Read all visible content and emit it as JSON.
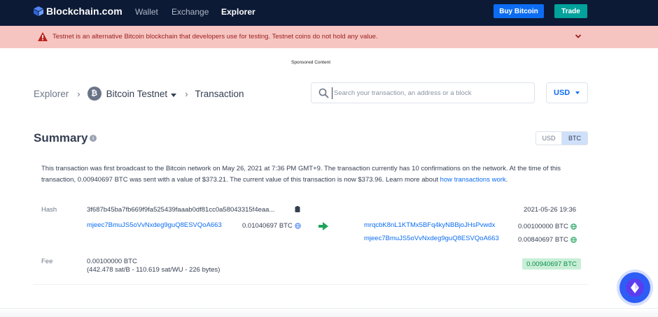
{
  "brand": {
    "name": "Blockchain.com"
  },
  "nav": {
    "links": [
      {
        "label": "Wallet",
        "active": false
      },
      {
        "label": "Exchange",
        "active": false
      },
      {
        "label": "Explorer",
        "active": true
      }
    ],
    "buy_button": "Buy Bitcoin",
    "trade_button": "Trade"
  },
  "alert": {
    "text": "Testnet is an alternative Bitcoin blockchain that developers use for testing. Testnet coins do not hold any value."
  },
  "sponsored": "Sponsored Content",
  "breadcrumb": {
    "root": "Explorer",
    "network": "Bitcoin Testnet",
    "current": "Transaction",
    "coin_glyph": "₿"
  },
  "search": {
    "placeholder": "Search your transaction, an address or a block"
  },
  "currency": {
    "selected": "USD"
  },
  "summary": {
    "title": "Summary",
    "info_glyph": "i",
    "toggle": {
      "options": [
        "USD",
        "BTC"
      ],
      "active": "BTC"
    },
    "desc_part1": "This transaction was first broadcast to the Bitcoin network on May 26, 2021 at 7:36 PM GMT+9.  The transaction currently has 10 confirmations on the network.  At the time of this transaction, 0.00940697 BTC was sent with a value of $373.21. The current value of this transaction is now $373.96.  Learn more about ",
    "desc_link": "how transactions work",
    "desc_end": "."
  },
  "transaction": {
    "hash_label": "Hash",
    "hash": "3f687b45ba7fb669f9fa525439faaab0df81cc0a58043315f4eaa...",
    "timestamp": "2021-05-26 19:36",
    "inputs": [
      {
        "address": "mjeec7BmuJS5oVvNxdeg9guQ8ESVQoA663",
        "amount": "0.01040697 BTC"
      }
    ],
    "outputs": [
      {
        "address": "mrqcbK8nL1KTMx5BFq4kyNBBjoJHsPvwdx",
        "amount": "0.00100000 BTC"
      },
      {
        "address": "mjeec7BmuJS5oVvNxdeg9guQ8ESVQoA663",
        "amount": "0.00840697 BTC"
      }
    ],
    "fee_label": "Fee",
    "fee": "0.00100000 BTC",
    "fee_detail": "(442.478 sat/B - 110.619 sat/WU - 226 bytes)",
    "total": "0.00940697 BTC"
  },
  "colors": {
    "nav_bg": "#0c1a35",
    "accent_blue": "#0c6cf2",
    "trade_teal": "#00a29b",
    "alert_bg": "#f6c5c1",
    "alert_text": "#9b1d1d",
    "success_green": "#0e8a4f",
    "fab_blue": "#2e5df5"
  },
  "icons": [
    "blockchain-logo-icon",
    "warning-icon",
    "chevron-down-icon",
    "bitcoin-coin-icon",
    "search-icon",
    "info-icon",
    "copy-icon",
    "globe-icon",
    "arrow-right-icon",
    "chat-widget-icon"
  ]
}
